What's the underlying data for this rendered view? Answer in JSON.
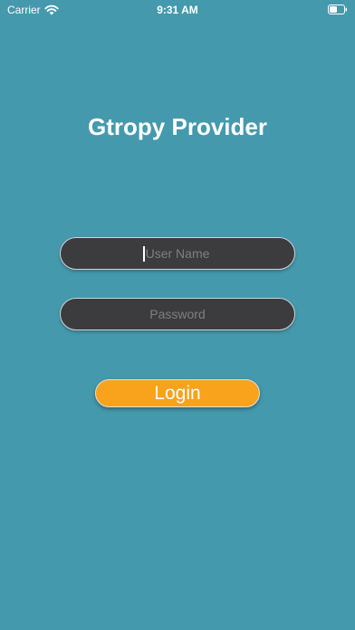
{
  "status_bar": {
    "carrier": "Carrier",
    "time": "9:31 AM",
    "wifi_icon": "wifi-icon",
    "battery_icon": "battery-icon"
  },
  "app": {
    "title": "Gtropy Provider"
  },
  "form": {
    "username": {
      "placeholder": "User Name",
      "value": ""
    },
    "password": {
      "placeholder": "Password",
      "value": ""
    },
    "login_label": "Login"
  },
  "colors": {
    "background": "#4599ad",
    "field_background": "#3c3c3e",
    "login_button": "#f9a21b",
    "title_text": "#ffffff"
  }
}
